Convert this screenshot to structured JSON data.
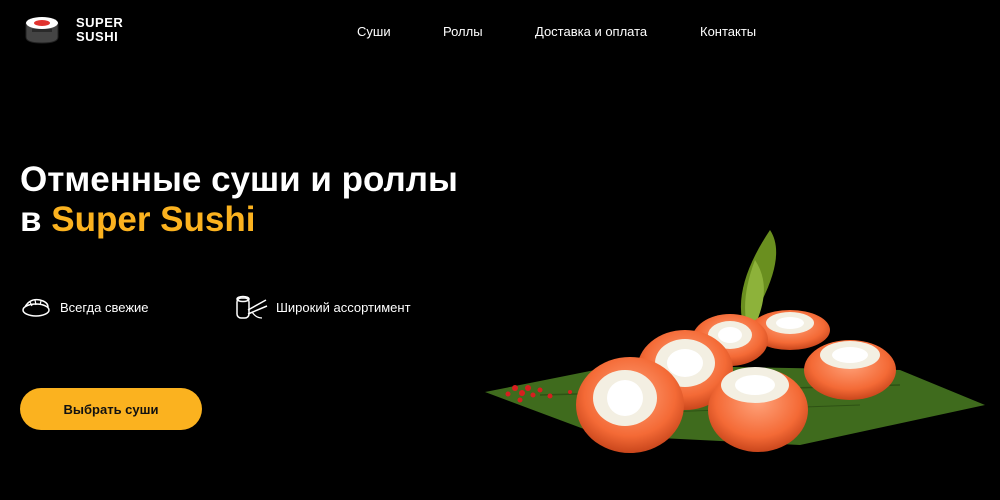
{
  "brand": {
    "line1": "SUPER",
    "line2": "SUSHI",
    "logo_icon": "sushi-roll-icon"
  },
  "nav": {
    "items": [
      {
        "label": "Суши"
      },
      {
        "label": "Роллы"
      },
      {
        "label": "Доставка и оплата"
      },
      {
        "label": "Контакты"
      }
    ]
  },
  "hero": {
    "title_line1": "Отменные суши и роллы",
    "title_prefix": "в ",
    "title_accent": "Super Sushi"
  },
  "features": [
    {
      "label": "Всегда свежие",
      "icon": "sushi-icon"
    },
    {
      "label": "Широкий ассортимент",
      "icon": "rolls-chopsticks-icon"
    }
  ],
  "cta": {
    "label": "Выбрать суши"
  },
  "colors": {
    "accent": "#fbb21f",
    "background": "#000000",
    "text": "#ffffff"
  }
}
